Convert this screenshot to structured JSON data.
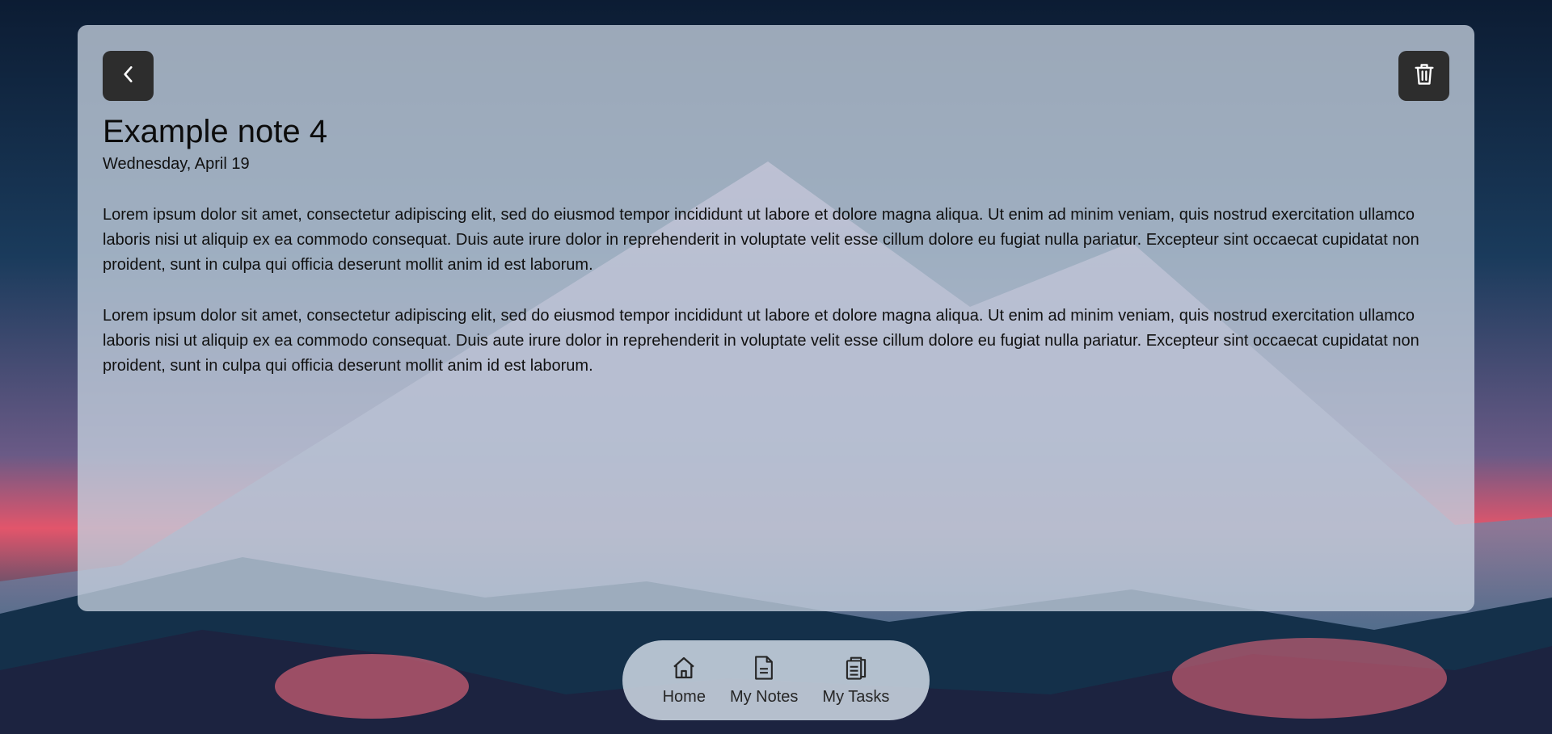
{
  "note": {
    "title": "Example note 4",
    "date": "Wednesday, April 19",
    "paragraphs": [
      "Lorem ipsum dolor sit amet, consectetur adipiscing elit, sed do eiusmod tempor incididunt ut labore et dolore magna aliqua. Ut enim ad minim veniam, quis nostrud exercitation ullamco laboris nisi ut aliquip ex ea commodo consequat. Duis aute irure dolor in reprehenderit in voluptate velit esse cillum dolore eu fugiat nulla pariatur. Excepteur sint occaecat cupidatat non proident, sunt in culpa qui officia deserunt mollit anim id est laborum.",
      "Lorem ipsum dolor sit amet, consectetur adipiscing elit, sed do eiusmod tempor incididunt ut labore et dolore magna aliqua. Ut enim ad minim veniam, quis nostrud exercitation ullamco laboris nisi ut aliquip ex ea commodo consequat. Duis aute irure dolor in reprehenderit in voluptate velit esse cillum dolore eu fugiat nulla pariatur. Excepteur sint occaecat cupidatat non proident, sunt in culpa qui officia deserunt mollit anim id est laborum."
    ]
  },
  "toolbar": {
    "back_icon": "chevron-left-icon",
    "delete_icon": "trash-icon"
  },
  "nav": {
    "items": [
      {
        "label": "Home",
        "icon": "home-icon"
      },
      {
        "label": "My Notes",
        "icon": "note-icon"
      },
      {
        "label": "My Tasks",
        "icon": "clipboard-icon"
      }
    ]
  },
  "colors": {
    "button_bg": "#2d2d2d",
    "panel": "#c4d0de",
    "accent_sunset": "#e8546a"
  }
}
